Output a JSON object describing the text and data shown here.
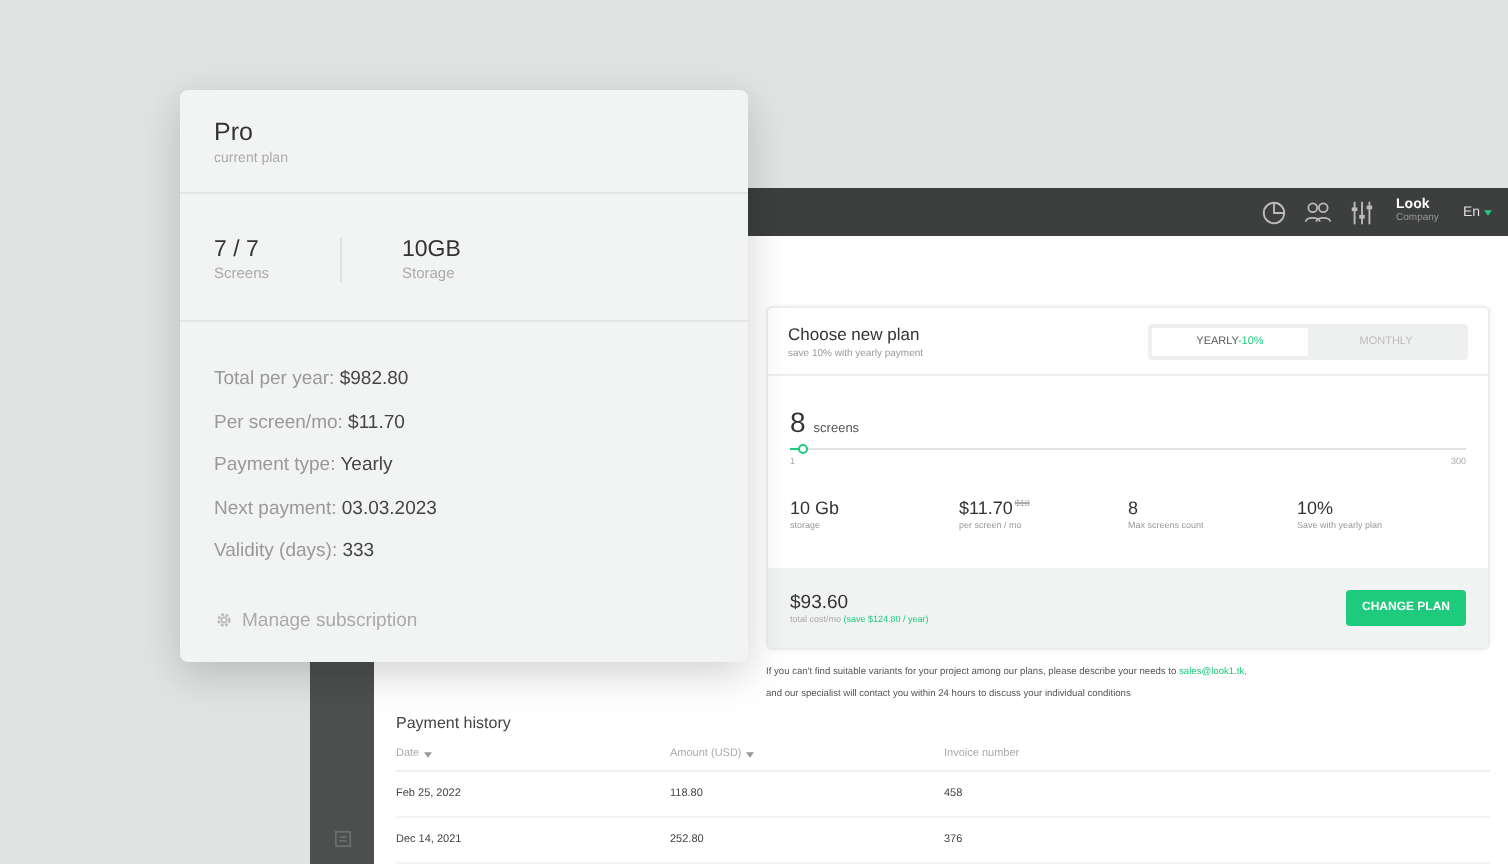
{
  "top_bar": {
    "account_name": "Look",
    "account_type": "Company",
    "language": "En"
  },
  "current_plan": {
    "name": "Pro",
    "subtitle": "current plan",
    "stats": [
      {
        "value": "7 / 7",
        "label": "Screens"
      },
      {
        "value": "10GB",
        "label": "Storage"
      }
    ],
    "details": [
      {
        "label": "Total per year:",
        "value": "$982.80"
      },
      {
        "label": "Per screen/mo:",
        "value": "$11.70"
      },
      {
        "label": "Payment type:",
        "value": "Yearly"
      },
      {
        "label": "Next payment:",
        "value": "03.03.2023"
      },
      {
        "label": "Validity (days):",
        "value": "333"
      }
    ],
    "manage_link": "Manage subscription"
  },
  "new_plan": {
    "title": "Choose new plan",
    "subtitle": "save 10% with yearly payment",
    "billing_tabs": [
      {
        "label": "YEARLY",
        "badge": "-10%",
        "selected": true
      },
      {
        "label": "MONTHLY",
        "selected": false
      }
    ],
    "screens": {
      "value": "8",
      "unit": "screens",
      "level": 0.02,
      "min": "1",
      "max": "300"
    },
    "stats": [
      {
        "value": "10 Gb",
        "label": "storage"
      },
      {
        "value": "$11.70",
        "old_value": "$13",
        "label": "per screen / mo"
      },
      {
        "value": "8",
        "label": "Max screens count"
      },
      {
        "value": "10%",
        "label": "Save with yearly plan"
      }
    ],
    "total": "$93.60",
    "total_label": "total cost/mo",
    "saving": "(save $124.80 / year)",
    "button": "CHANGE PLAN"
  },
  "note": {
    "text": "If you can't find suitable variants for your project among our plans, please describe your needs to",
    "link": "sales@look1.tk,",
    "line2": "and our specialist will contact you within 24 hours to discuss your individual conditions"
  },
  "payment_history": {
    "title": "Payment history",
    "columns": [
      {
        "label": "Date",
        "sortable": true
      },
      {
        "label": "Amount (USD)",
        "sortable": true
      },
      {
        "label": "Invoice number",
        "sortable": false
      }
    ],
    "rows": [
      [
        "Feb 25, 2022",
        "118.80",
        "458"
      ],
      [
        "Dec 14, 2021",
        "252.80",
        "376"
      ]
    ]
  }
}
